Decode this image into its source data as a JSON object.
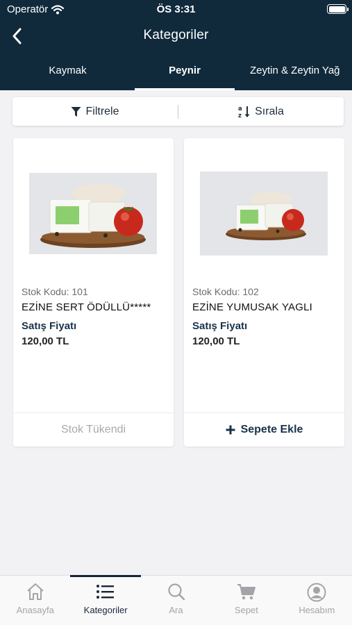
{
  "status_bar": {
    "carrier": "Operatör",
    "time": "ÖS 3:31"
  },
  "nav": {
    "title": "Kategoriler"
  },
  "tabs": [
    {
      "label": "Kaymak"
    },
    {
      "label": "Peynir"
    },
    {
      "label": "Zeytin & Zeytin Yağ"
    }
  ],
  "toolbar": {
    "filter_label": "Filtrele",
    "sort_label": "Sırala"
  },
  "products": [
    {
      "code": "Stok Kodu: 101",
      "name": "EZİNE SERT ÖDÜLLÜ*****",
      "price_label": "Satış Fiyatı",
      "price": "120,00 TL",
      "action": "Stok Tükendi"
    },
    {
      "code": "Stok Kodu: 102",
      "name": "EZİNE YUMUSAK YAGLI",
      "price_label": "Satış Fiyatı",
      "price": "120,00 TL",
      "action": "Sepete Ekle"
    }
  ],
  "bottom_nav": [
    {
      "label": "Anasayfa"
    },
    {
      "label": "Kategoriler"
    },
    {
      "label": "Ara"
    },
    {
      "label": "Sepet"
    },
    {
      "label": "Hesabım"
    }
  ],
  "colors": {
    "header_bg": "#102a3c",
    "accent": "#18324a",
    "page_bg": "#f2f2f4"
  },
  "icons": [
    "wifi-icon",
    "battery-icon",
    "back-icon",
    "filter-icon",
    "sort-icon",
    "plus-icon",
    "home-icon",
    "list-icon",
    "search-icon",
    "cart-icon",
    "account-icon"
  ]
}
